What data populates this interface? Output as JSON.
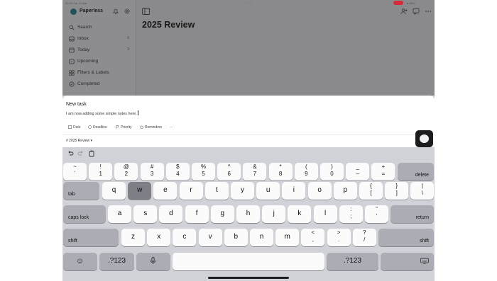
{
  "status": {
    "time": "09:45",
    "date": "Sat 15 Mar",
    "battery": "88%"
  },
  "app": {
    "name": "Paperless",
    "sidebar": [
      {
        "label": "Search",
        "count": "",
        "icon": "search-icon"
      },
      {
        "label": "Inbox",
        "count": "6",
        "icon": "inbox-icon"
      },
      {
        "label": "Today",
        "count": "3",
        "icon": "calendar-today-icon"
      },
      {
        "label": "Upcoming",
        "count": "",
        "icon": "calendar-upcoming-icon"
      },
      {
        "label": "Filters & Labels",
        "count": "",
        "icon": "filters-icon"
      },
      {
        "label": "Completed",
        "count": "",
        "icon": "check-circle-icon"
      }
    ],
    "page_title": "2025 Review"
  },
  "task": {
    "title": "New task",
    "description": "I am now adding some simple notes here.",
    "chips": [
      "Date",
      "Deadline",
      "Priority",
      "Reminders",
      "···"
    ],
    "project": "2025 Review",
    "project_caret": "▾"
  },
  "keyboard": {
    "row1": [
      [
        "~",
        "`"
      ],
      [
        "!",
        "1"
      ],
      [
        "@",
        "2"
      ],
      [
        "#",
        "3"
      ],
      [
        "$",
        "4"
      ],
      [
        "%",
        "5"
      ],
      [
        "^",
        "6"
      ],
      [
        "&",
        "7"
      ],
      [
        "*",
        "8"
      ],
      [
        "(",
        "9"
      ],
      [
        ")",
        "0"
      ],
      [
        "_",
        "–"
      ],
      [
        "+",
        "="
      ]
    ],
    "delete": "delete",
    "tab": "tab",
    "row2": [
      "q",
      "w",
      "e",
      "r",
      "t",
      "y",
      "u",
      "i",
      "o",
      "p"
    ],
    "row2_sym": [
      [
        "{",
        "["
      ],
      [
        "}",
        "]"
      ],
      [
        "|",
        "\\"
      ]
    ],
    "caps": "caps lock",
    "row3": [
      "a",
      "s",
      "d",
      "f",
      "g",
      "h",
      "j",
      "k",
      "l"
    ],
    "row3_sym": [
      [
        ":",
        ";"
      ],
      [
        "”",
        "’"
      ]
    ],
    "return": "return",
    "shift": "shift",
    "row4": [
      "z",
      "x",
      "c",
      "v",
      "b",
      "n",
      "m"
    ],
    "row4_sym": [
      [
        "<",
        ","
      ],
      [
        ">",
        "."
      ],
      [
        "?",
        "/"
      ]
    ],
    "num": ".?123",
    "pressed_key": "w"
  }
}
